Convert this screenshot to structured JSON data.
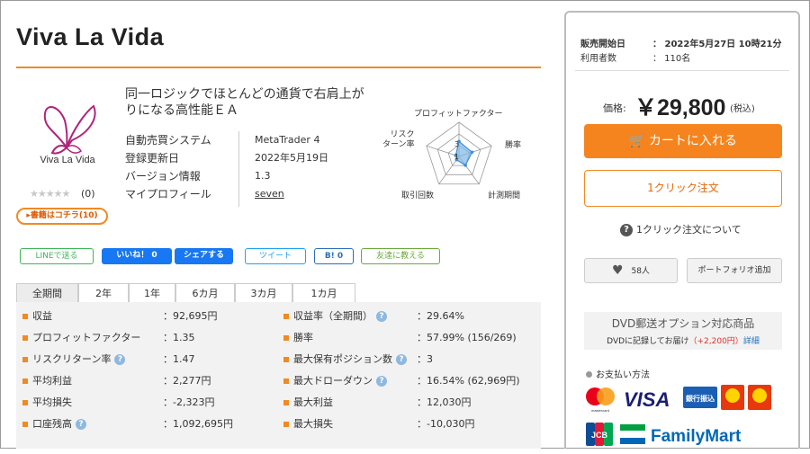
{
  "product": {
    "title": "Viva La Vida",
    "logo_text": "Viva La Vida",
    "tagline": "同一ロジックでほとんどの通貨で右肩上がりになる高性能ＥＡ",
    "stars": "★★★★★",
    "star_count": "(0)",
    "reviews_button": "▸書籍はコチラ(10)"
  },
  "info": [
    {
      "label": "自動売買システム",
      "value": "MetaTrader 4"
    },
    {
      "label": "登録更新日",
      "value": "2022年5月19日"
    },
    {
      "label": "バージョン情報",
      "value": "1.3"
    },
    {
      "label": "マイプロフィール",
      "value": "seven"
    }
  ],
  "radar": {
    "labels": {
      "top": "プロフィットファクター",
      "right": "勝率",
      "bottom_right": "計測期間",
      "bottom_left": "取引回数",
      "left": "リスク\nターン率"
    },
    "scale_label": "3",
    "scale_label2": "1",
    "values": [
      2.2,
      2.0,
      1.6,
      0.6,
      0.5
    ],
    "max": 5,
    "colors": {
      "fill": "#7eb6e6",
      "stroke": "#3d8fd6",
      "grid": "#999999"
    }
  },
  "share": {
    "line": "LINEで送る",
    "like": "いいね！ 0",
    "share": "シェアする",
    "tweet": "ツイート",
    "hatena": "B! 0",
    "friend": "友達に教える"
  },
  "tabs": [
    "全期間",
    "2年",
    "1年",
    "6カ月",
    "3カ月",
    "1カ月"
  ],
  "stats_left": [
    {
      "label": "収益",
      "value": "：92,695円",
      "help": false
    },
    {
      "label": "プロフィットファクター",
      "value": "：1.35",
      "help": false
    },
    {
      "label": "リスクリターン率",
      "value": "：1.47",
      "help": true
    },
    {
      "label": "平均利益",
      "value": "：2,277円",
      "help": false
    },
    {
      "label": "平均損失",
      "value": "：-2,323円",
      "help": false
    },
    {
      "label": "口座残高",
      "value": "：1,092,695円",
      "help": true
    }
  ],
  "stats_right": [
    {
      "label": "収益率（全期間）",
      "value": "：29.64%",
      "help": true
    },
    {
      "label": "勝率",
      "value": "：57.99% (156/269)",
      "help": false
    },
    {
      "label": "最大保有ポジション数",
      "value": "：3",
      "help": true
    },
    {
      "label": "最大ドローダウン",
      "value": "：16.54% (62,969円)",
      "help": true
    },
    {
      "label": "最大利益",
      "value": "：12,030円",
      "help": false
    },
    {
      "label": "最大損失",
      "value": "：-10,030円",
      "help": false
    }
  ],
  "sidebar": {
    "sale_start_label": "販売開始日",
    "sale_start_value": "：  2022年5月27日 10時21分",
    "users_label": "利用者数",
    "users_value": "：  110名",
    "price_label": "価格:",
    "price": "￥29,800",
    "price_tax": "(税込)",
    "cart_button": "カートに入れる",
    "oneclick_button": "1クリック注文",
    "oneclick_about": "1クリック注文について",
    "fav_button": "58人",
    "portfolio_button": "ポートフォリオ追加",
    "dvd_title": "DVD郵送オプション対応商品",
    "dvd_sub1": "DVDに記録してお届け",
    "dvd_sub2": "（+2,200円）",
    "dvd_sub3": "詳細",
    "pay_title": "お支払い方法",
    "pay_visa": "VISA",
    "pay_bank": "銀行振込",
    "pay_jcb": "JCB",
    "pay_familymart": "FamilyMart",
    "pay_mastercard": "mastercard"
  },
  "colors": {
    "accent": "#f08a24",
    "cart": "#f5841f",
    "link": "#1a6fc0"
  }
}
